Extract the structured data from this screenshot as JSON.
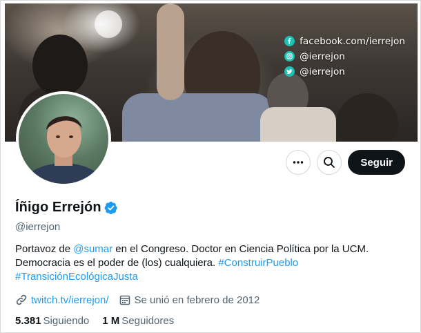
{
  "banner": {
    "social": [
      {
        "icon": "facebook-icon",
        "text": "facebook.com/ierrejon"
      },
      {
        "icon": "instagram-icon",
        "text": "@ierrejon"
      },
      {
        "icon": "twitter-icon",
        "text": "@ierrejon"
      }
    ]
  },
  "actions": {
    "more_icon": "more-icon",
    "search_icon": "search-icon",
    "follow_label": "Seguir"
  },
  "profile": {
    "name": "Íñigo Errejón",
    "verified": true,
    "handle": "@ierrejon",
    "bio": {
      "part1": "Portavoz de ",
      "mention": "@sumar",
      "part2": " en el Congreso. Doctor en Ciencia Política por la UCM.",
      "part3": "Democracia es el poder de (los) cualquiera. ",
      "hashtag1": "#ConstruirPueblo",
      "hashtag2": "#TransiciónEcológicaJusta"
    },
    "website": "twitch.tv/ierrejon/",
    "joined": "Se unió en febrero de 2012",
    "following_count": "5.381",
    "following_label": "Siguiendo",
    "followers_count": "1 M",
    "followers_label": "Seguidores"
  },
  "colors": {
    "accent": "#1d9bf0",
    "text": "#0f1419",
    "muted": "#536471",
    "social_icon": "#1ec0b3"
  }
}
